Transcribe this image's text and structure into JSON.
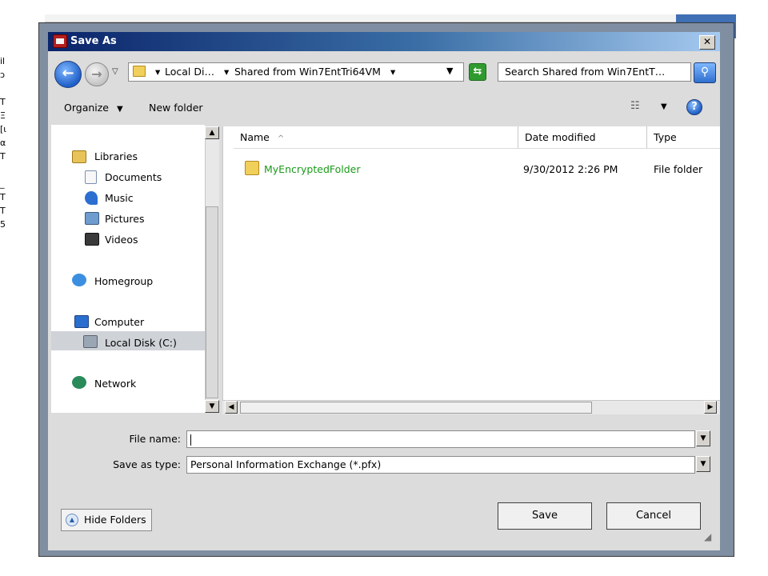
{
  "background": {
    "left_strip_text": "il\nɔ\n\nT\nΞ\n[ι\nα\nT\n\n_\nT\nT\n5"
  },
  "window": {
    "title": "Save As"
  },
  "address_bar": {
    "segments": [
      "Local Di…",
      "Shared from Win7EntTri64VM"
    ],
    "separator_glyph": "▾"
  },
  "search": {
    "text": "Search Shared from Win7EntT…"
  },
  "toolbar": {
    "organize_label": "Organize",
    "new_folder_label": "New folder"
  },
  "navigation": {
    "items": [
      {
        "label": "Libraries",
        "icon": "libraries-icon"
      },
      {
        "label": "Documents",
        "icon": "documents-icon"
      },
      {
        "label": "Music",
        "icon": "music-icon"
      },
      {
        "label": "Pictures",
        "icon": "pictures-icon"
      },
      {
        "label": "Videos",
        "icon": "videos-icon"
      },
      {
        "label": "Homegroup",
        "icon": "homegroup-icon"
      },
      {
        "label": "Computer",
        "icon": "computer-icon"
      },
      {
        "label": "Local Disk (C:)",
        "icon": "local-disk-icon",
        "selected": true
      },
      {
        "label": "Network",
        "icon": "network-icon"
      }
    ]
  },
  "file_list": {
    "columns": [
      "Name",
      "Date modified",
      "Type"
    ],
    "sort_indicator": "^",
    "rows": [
      {
        "name": "MyEncryptedFolder",
        "date_modified": "9/30/2012 2:26 PM",
        "type": "File folder"
      }
    ]
  },
  "form": {
    "file_name_label": "File name:",
    "file_name_value": "",
    "save_type_label": "Save as type:",
    "save_type_value": "Personal Information Exchange (*.pfx)"
  },
  "buttons": {
    "hide_folders": "Hide Folders",
    "save": "Save",
    "cancel": "Cancel"
  },
  "colors": {
    "title_gradient_start": "#0a246a",
    "compressed_file_green": "#1a9a1a"
  }
}
